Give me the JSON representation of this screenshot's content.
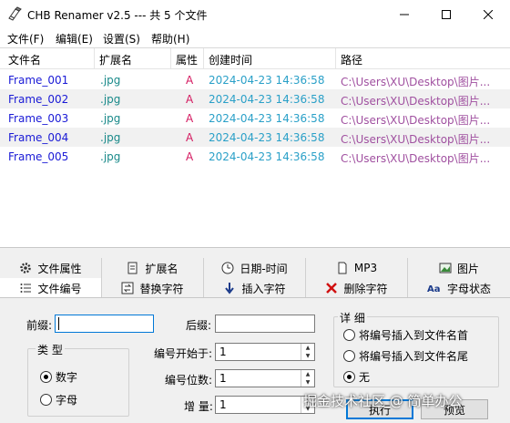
{
  "window": {
    "title": "CHB Renamer v2.5 --- 共 5 个文件"
  },
  "menu": [
    "文件(F)",
    "编辑(E)",
    "设置(S)",
    "帮助(H)"
  ],
  "list": {
    "headers": [
      "文件名",
      "扩展名",
      "属性",
      "创建时间",
      "路径"
    ],
    "rows": [
      {
        "name": "Frame_001",
        "ext": ".jpg",
        "attr": "A",
        "time": "2024-04-23 14:36:58",
        "path": "C:\\Users\\XU\\Desktop\\图片..."
      },
      {
        "name": "Frame_002",
        "ext": ".jpg",
        "attr": "A",
        "time": "2024-04-23 14:36:58",
        "path": "C:\\Users\\XU\\Desktop\\图片..."
      },
      {
        "name": "Frame_003",
        "ext": ".jpg",
        "attr": "A",
        "time": "2024-04-23 14:36:58",
        "path": "C:\\Users\\XU\\Desktop\\图片..."
      },
      {
        "name": "Frame_004",
        "ext": ".jpg",
        "attr": "A",
        "time": "2024-04-23 14:36:58",
        "path": "C:\\Users\\XU\\Desktop\\图片..."
      },
      {
        "name": "Frame_005",
        "ext": ".jpg",
        "attr": "A",
        "time": "2024-04-23 14:36:58",
        "path": "C:\\Users\\XU\\Desktop\\图片..."
      }
    ]
  },
  "tabs_top": [
    "文件属性",
    "扩展名",
    "日期-时间",
    "MP3",
    "图片"
  ],
  "tabs_bottom": [
    "文件编号",
    "替换字符",
    "插入字符",
    "删除字符",
    "字母状态"
  ],
  "panel": {
    "prefix_label": "前缀:",
    "prefix_value": "",
    "suffix_label": "后缀:",
    "suffix_value": "",
    "type_group": "类 型",
    "type_options": [
      "数字",
      "字母"
    ],
    "type_selected": "数字",
    "start_label": "编号开始于:",
    "start_value": "1",
    "digits_label": "编号位数:",
    "digits_value": "1",
    "step_label": "增 量:",
    "step_value": "1",
    "detail_group": "详 细",
    "detail_options": [
      "将编号插入到文件名首",
      "将编号插入到文件名尾",
      "无"
    ],
    "detail_selected": "无",
    "execute_label": "执行",
    "preview_label": "预览"
  },
  "watermark": "掘金技术社区 @ 简单办公",
  "colors": {
    "name": "#1a1ad6",
    "ext": "#1a8a8a",
    "attr": "#d41a60",
    "time": "#2aa0c8",
    "path": "#a050a0",
    "accent": "#0078d7"
  }
}
